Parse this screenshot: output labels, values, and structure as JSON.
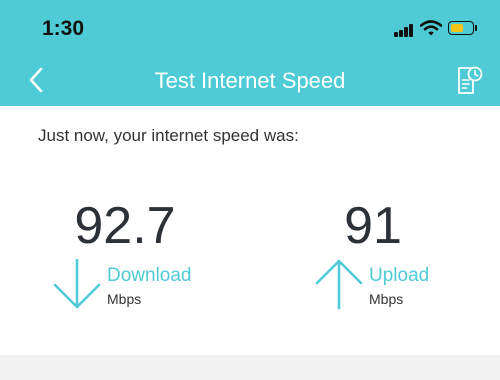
{
  "status_bar": {
    "time": "1:30",
    "battery_color": "#f2c515",
    "battery_level": 0.6,
    "icons": [
      "signal-icon",
      "wifi-icon",
      "battery-icon"
    ]
  },
  "nav": {
    "title": "Test Internet Speed",
    "back_icon": "chevron-left-icon",
    "history_icon": "history-document-icon"
  },
  "result": {
    "caption": "Just now, your internet speed was:",
    "download": {
      "value": "92.7",
      "label": "Download",
      "unit": "Mbps",
      "icon": "arrow-down-icon"
    },
    "upload": {
      "value": "91",
      "label": "Upload",
      "unit": "Mbps",
      "icon": "arrow-up-icon"
    }
  },
  "colors": {
    "accent": "#4ecbd5",
    "value_text": "#2d3238"
  }
}
